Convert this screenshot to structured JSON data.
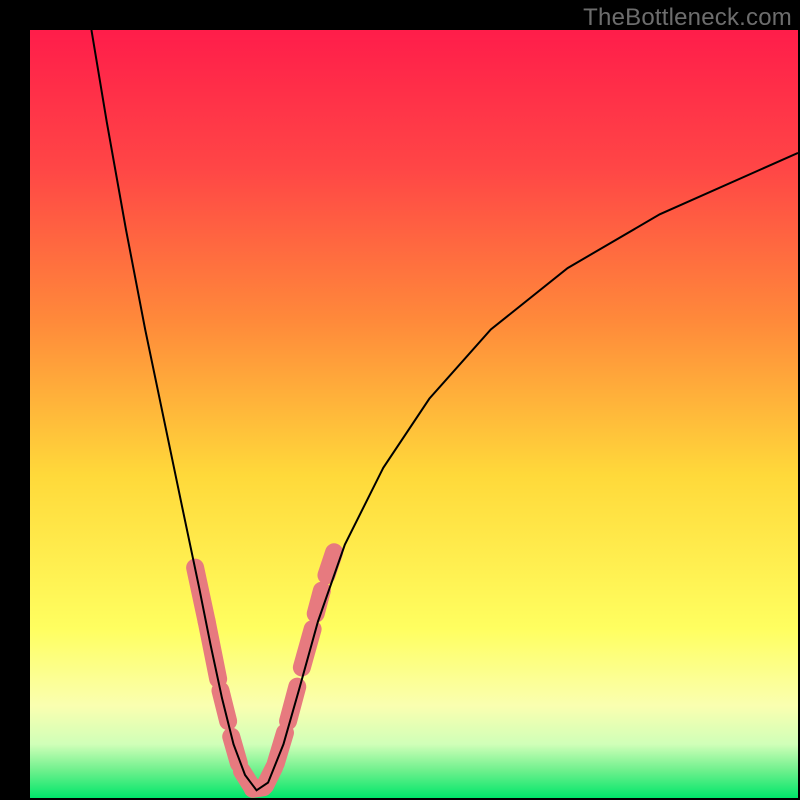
{
  "watermark": "TheBottleneck.com",
  "chart_data": {
    "type": "line",
    "title": "",
    "xlabel": "",
    "ylabel": "",
    "xlim": [
      0,
      100
    ],
    "ylim": [
      0,
      100
    ],
    "background_gradient": {
      "stops": [
        {
          "offset": 0.0,
          "color": "#ff1d4a"
        },
        {
          "offset": 0.18,
          "color": "#ff4646"
        },
        {
          "offset": 0.38,
          "color": "#ff8a3a"
        },
        {
          "offset": 0.58,
          "color": "#ffd93a"
        },
        {
          "offset": 0.78,
          "color": "#ffff60"
        },
        {
          "offset": 0.88,
          "color": "#faffb0"
        },
        {
          "offset": 0.93,
          "color": "#d0ffb8"
        },
        {
          "offset": 0.965,
          "color": "#6cf08c"
        },
        {
          "offset": 1.0,
          "color": "#00e66a"
        }
      ]
    },
    "curve": {
      "left_branch": [
        {
          "x": 8.0,
          "y": 100.0
        },
        {
          "x": 10.0,
          "y": 88.0
        },
        {
          "x": 12.5,
          "y": 74.0
        },
        {
          "x": 15.0,
          "y": 61.0
        },
        {
          "x": 17.5,
          "y": 49.0
        },
        {
          "x": 20.0,
          "y": 37.0
        },
        {
          "x": 22.0,
          "y": 27.5
        },
        {
          "x": 23.5,
          "y": 20.0
        },
        {
          "x": 25.0,
          "y": 13.0
        },
        {
          "x": 26.5,
          "y": 7.0
        },
        {
          "x": 28.0,
          "y": 3.0
        },
        {
          "x": 29.5,
          "y": 1.0
        }
      ],
      "right_branch": [
        {
          "x": 29.5,
          "y": 1.0
        },
        {
          "x": 31.0,
          "y": 2.0
        },
        {
          "x": 33.0,
          "y": 7.0
        },
        {
          "x": 35.0,
          "y": 14.0
        },
        {
          "x": 37.5,
          "y": 23.0
        },
        {
          "x": 41.0,
          "y": 33.0
        },
        {
          "x": 46.0,
          "y": 43.0
        },
        {
          "x": 52.0,
          "y": 52.0
        },
        {
          "x": 60.0,
          "y": 61.0
        },
        {
          "x": 70.0,
          "y": 69.0
        },
        {
          "x": 82.0,
          "y": 76.0
        },
        {
          "x": 100.0,
          "y": 84.0
        }
      ]
    },
    "highlight_segments": [
      {
        "x0": 21.5,
        "y0": 30.0,
        "x1": 23.0,
        "y1": 23.0
      },
      {
        "x0": 23.0,
        "y0": 23.0,
        "x1": 24.5,
        "y1": 15.5
      },
      {
        "x0": 24.8,
        "y0": 14.0,
        "x1": 25.8,
        "y1": 10.0
      },
      {
        "x0": 26.2,
        "y0": 8.0,
        "x1": 27.2,
        "y1": 4.5
      },
      {
        "x0": 27.6,
        "y0": 3.5,
        "x1": 28.8,
        "y1": 1.6
      },
      {
        "x0": 29.0,
        "y0": 1.2,
        "x1": 30.4,
        "y1": 1.4
      },
      {
        "x0": 30.6,
        "y0": 1.6,
        "x1": 31.8,
        "y1": 4.0
      },
      {
        "x0": 32.0,
        "y0": 4.5,
        "x1": 33.2,
        "y1": 8.5
      },
      {
        "x0": 33.6,
        "y0": 10.0,
        "x1": 34.8,
        "y1": 14.5
      },
      {
        "x0": 35.4,
        "y0": 17.0,
        "x1": 36.8,
        "y1": 22.0
      },
      {
        "x0": 37.2,
        "y0": 24.0,
        "x1": 38.0,
        "y1": 27.0
      },
      {
        "x0": 38.6,
        "y0": 29.0,
        "x1": 39.6,
        "y1": 32.0
      }
    ],
    "highlight_color": "#e77a7f",
    "curve_color": "#000000"
  }
}
